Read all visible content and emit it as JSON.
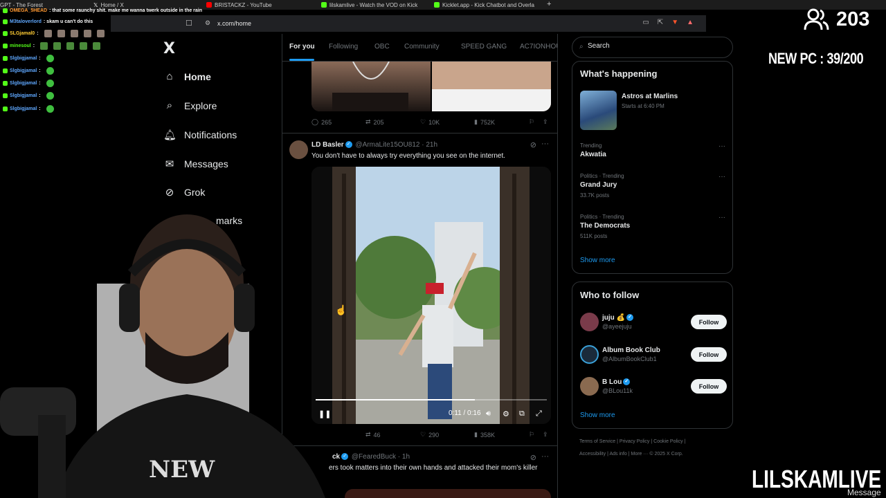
{
  "browser": {
    "tabs": [
      {
        "label": "GPT - The Forest",
        "color": "#888888"
      },
      {
        "label": "Home / X",
        "color": "#ffffff"
      },
      {
        "label": "BRISTACKZ - YouTube",
        "color": "#ff0000"
      },
      {
        "label": "lilskamlive - Watch the VOD on Kick",
        "color": "#53fc18"
      },
      {
        "label": "Kicklet.app - Kick Chatbot and Overla",
        "color": "#53fc18"
      }
    ],
    "new_tab": "+",
    "url": "x.com/home"
  },
  "x": {
    "logo": "X",
    "nav": [
      {
        "label": "Home",
        "icon": "home-icon",
        "active": true
      },
      {
        "label": "Explore",
        "icon": "search-icon"
      },
      {
        "label": "Notifications",
        "icon": "bell-icon"
      },
      {
        "label": "Messages",
        "icon": "envelope-icon"
      },
      {
        "label": "Grok",
        "icon": "grok-icon"
      },
      {
        "label": "marks",
        "icon": "bookmark-icon"
      }
    ],
    "feed_tabs": [
      "For you",
      "Following",
      "OBC",
      "Community",
      "SPEED GANG",
      "AC7IONHOU"
    ],
    "tweet1_actions": {
      "replies": "265",
      "reposts": "205",
      "likes": "10K",
      "views": "752K"
    },
    "tweet2": {
      "name": "LD Basler",
      "handle": "@ArmaLite15OU812",
      "time": "21h",
      "text": "You don't have to always try everything you see on the internet.",
      "video_time": "0:11 / 0:16",
      "video_progress": 0.6875,
      "actions": {
        "reposts": "46",
        "likes": "290",
        "views": "358K"
      }
    },
    "tweet3": {
      "name": "ck",
      "handle": "@FearedBuck",
      "time": "1h",
      "text": "ers took matters into their own hands and attacked their mom's killer"
    }
  },
  "sidebar": {
    "search_placeholder": "Search",
    "whats_happening": {
      "title": "What's happening",
      "featured": {
        "title": "Astros at Marlins",
        "subtitle": "Starts at 6:40 PM"
      },
      "trends": [
        {
          "context": "Trending",
          "title": "Akwatia",
          "count": ""
        },
        {
          "context": "Politics · Trending",
          "title": "Grand Jury",
          "count": "33.7K posts"
        },
        {
          "context": "Politics · Trending",
          "title": "The Democrats",
          "count": "511K posts"
        }
      ],
      "show_more": "Show more"
    },
    "who_to_follow": {
      "title": "Who to follow",
      "accounts": [
        {
          "name": "juju 💰",
          "handle": "@ayeejuju",
          "verified": true,
          "button": "Follow",
          "color": "#7a3b4a"
        },
        {
          "name": "Album Book Club",
          "handle": "@AlbumBookClub1",
          "verified": false,
          "button": "Follow",
          "color": "#1a2a3a"
        },
        {
          "name": "B Lou",
          "handle": "@BLou11k",
          "verified": true,
          "button": "Follow",
          "color": "#8a6a50"
        }
      ],
      "show_more": "Show more"
    },
    "footer": {
      "line1": [
        "Terms of Service",
        "|",
        "Privacy Policy",
        "|",
        "Cookie Policy",
        "|"
      ],
      "line2": [
        "Accessibility",
        "|",
        "Ads info",
        "|",
        "More ···",
        "© 2025 X Corp."
      ]
    }
  },
  "stream": {
    "viewers": "203",
    "goal": "NEW PC : 39/200",
    "brand": "LILSKAMLIVE",
    "message_tag": "Message",
    "chat": [
      {
        "user": "OMEGA_5HEAD",
        "msg": ": that some raunchy shit. make me wanna twerk outside in the rain",
        "color": "#ff9933",
        "emotes": 0
      },
      {
        "user": "M3taloverlord",
        "msg": ": skam u can't do this",
        "color": "#5fa8ff",
        "emotes": 0
      },
      {
        "user": "SLGjamal0",
        "msg": ":",
        "color": "#ffcc33",
        "emotes": 5,
        "emote_type": "face"
      },
      {
        "user": "minesoul",
        "msg": ":",
        "color": "#53fc18",
        "emotes": 5,
        "emote_type": "pepe"
      },
      {
        "user": "Slgbigjamal",
        "msg": ":",
        "color": "#5fa8ff",
        "emotes": 1,
        "emote_type": "green"
      },
      {
        "user": "Slgbigjamal",
        "msg": ":",
        "color": "#5fa8ff",
        "emotes": 1,
        "emote_type": "green"
      },
      {
        "user": "Slgbigjamal",
        "msg": ":",
        "color": "#5fa8ff",
        "emotes": 1,
        "emote_type": "green"
      },
      {
        "user": "Slgbigjamal",
        "msg": ":",
        "color": "#5fa8ff",
        "emotes": 1,
        "emote_type": "green"
      },
      {
        "user": "Slgbigjamal",
        "msg": ":",
        "color": "#5fa8ff",
        "emotes": 1,
        "emote_type": "green"
      }
    ]
  }
}
